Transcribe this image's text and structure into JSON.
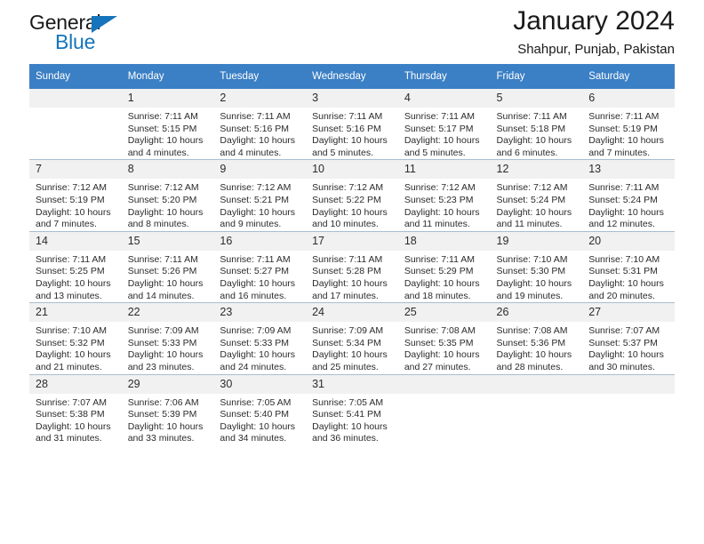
{
  "brand": {
    "name_top": "General",
    "name_bottom": "Blue",
    "accent_color": "#1574bb",
    "triangle_icon": "triangle-icon"
  },
  "header": {
    "month_title": "January 2024",
    "location": "Shahpur, Punjab, Pakistan"
  },
  "calendar": {
    "header_color": "#3b7fc4",
    "daynum_background": "#f1f1f1",
    "weekdays": [
      "Sunday",
      "Monday",
      "Tuesday",
      "Wednesday",
      "Thursday",
      "Friday",
      "Saturday"
    ],
    "weeks": [
      [
        {
          "day": "",
          "lines": []
        },
        {
          "day": "1",
          "lines": [
            "Sunrise: 7:11 AM",
            "Sunset: 5:15 PM",
            "Daylight: 10 hours",
            "and 4 minutes."
          ]
        },
        {
          "day": "2",
          "lines": [
            "Sunrise: 7:11 AM",
            "Sunset: 5:16 PM",
            "Daylight: 10 hours",
            "and 4 minutes."
          ]
        },
        {
          "day": "3",
          "lines": [
            "Sunrise: 7:11 AM",
            "Sunset: 5:16 PM",
            "Daylight: 10 hours",
            "and 5 minutes."
          ]
        },
        {
          "day": "4",
          "lines": [
            "Sunrise: 7:11 AM",
            "Sunset: 5:17 PM",
            "Daylight: 10 hours",
            "and 5 minutes."
          ]
        },
        {
          "day": "5",
          "lines": [
            "Sunrise: 7:11 AM",
            "Sunset: 5:18 PM",
            "Daylight: 10 hours",
            "and 6 minutes."
          ]
        },
        {
          "day": "6",
          "lines": [
            "Sunrise: 7:11 AM",
            "Sunset: 5:19 PM",
            "Daylight: 10 hours",
            "and 7 minutes."
          ]
        }
      ],
      [
        {
          "day": "7",
          "lines": [
            "Sunrise: 7:12 AM",
            "Sunset: 5:19 PM",
            "Daylight: 10 hours",
            "and 7 minutes."
          ]
        },
        {
          "day": "8",
          "lines": [
            "Sunrise: 7:12 AM",
            "Sunset: 5:20 PM",
            "Daylight: 10 hours",
            "and 8 minutes."
          ]
        },
        {
          "day": "9",
          "lines": [
            "Sunrise: 7:12 AM",
            "Sunset: 5:21 PM",
            "Daylight: 10 hours",
            "and 9 minutes."
          ]
        },
        {
          "day": "10",
          "lines": [
            "Sunrise: 7:12 AM",
            "Sunset: 5:22 PM",
            "Daylight: 10 hours",
            "and 10 minutes."
          ]
        },
        {
          "day": "11",
          "lines": [
            "Sunrise: 7:12 AM",
            "Sunset: 5:23 PM",
            "Daylight: 10 hours",
            "and 11 minutes."
          ]
        },
        {
          "day": "12",
          "lines": [
            "Sunrise: 7:12 AM",
            "Sunset: 5:24 PM",
            "Daylight: 10 hours",
            "and 11 minutes."
          ]
        },
        {
          "day": "13",
          "lines": [
            "Sunrise: 7:11 AM",
            "Sunset: 5:24 PM",
            "Daylight: 10 hours",
            "and 12 minutes."
          ]
        }
      ],
      [
        {
          "day": "14",
          "lines": [
            "Sunrise: 7:11 AM",
            "Sunset: 5:25 PM",
            "Daylight: 10 hours",
            "and 13 minutes."
          ]
        },
        {
          "day": "15",
          "lines": [
            "Sunrise: 7:11 AM",
            "Sunset: 5:26 PM",
            "Daylight: 10 hours",
            "and 14 minutes."
          ]
        },
        {
          "day": "16",
          "lines": [
            "Sunrise: 7:11 AM",
            "Sunset: 5:27 PM",
            "Daylight: 10 hours",
            "and 16 minutes."
          ]
        },
        {
          "day": "17",
          "lines": [
            "Sunrise: 7:11 AM",
            "Sunset: 5:28 PM",
            "Daylight: 10 hours",
            "and 17 minutes."
          ]
        },
        {
          "day": "18",
          "lines": [
            "Sunrise: 7:11 AM",
            "Sunset: 5:29 PM",
            "Daylight: 10 hours",
            "and 18 minutes."
          ]
        },
        {
          "day": "19",
          "lines": [
            "Sunrise: 7:10 AM",
            "Sunset: 5:30 PM",
            "Daylight: 10 hours",
            "and 19 minutes."
          ]
        },
        {
          "day": "20",
          "lines": [
            "Sunrise: 7:10 AM",
            "Sunset: 5:31 PM",
            "Daylight: 10 hours",
            "and 20 minutes."
          ]
        }
      ],
      [
        {
          "day": "21",
          "lines": [
            "Sunrise: 7:10 AM",
            "Sunset: 5:32 PM",
            "Daylight: 10 hours",
            "and 21 minutes."
          ]
        },
        {
          "day": "22",
          "lines": [
            "Sunrise: 7:09 AM",
            "Sunset: 5:33 PM",
            "Daylight: 10 hours",
            "and 23 minutes."
          ]
        },
        {
          "day": "23",
          "lines": [
            "Sunrise: 7:09 AM",
            "Sunset: 5:33 PM",
            "Daylight: 10 hours",
            "and 24 minutes."
          ]
        },
        {
          "day": "24",
          "lines": [
            "Sunrise: 7:09 AM",
            "Sunset: 5:34 PM",
            "Daylight: 10 hours",
            "and 25 minutes."
          ]
        },
        {
          "day": "25",
          "lines": [
            "Sunrise: 7:08 AM",
            "Sunset: 5:35 PM",
            "Daylight: 10 hours",
            "and 27 minutes."
          ]
        },
        {
          "day": "26",
          "lines": [
            "Sunrise: 7:08 AM",
            "Sunset: 5:36 PM",
            "Daylight: 10 hours",
            "and 28 minutes."
          ]
        },
        {
          "day": "27",
          "lines": [
            "Sunrise: 7:07 AM",
            "Sunset: 5:37 PM",
            "Daylight: 10 hours",
            "and 30 minutes."
          ]
        }
      ],
      [
        {
          "day": "28",
          "lines": [
            "Sunrise: 7:07 AM",
            "Sunset: 5:38 PM",
            "Daylight: 10 hours",
            "and 31 minutes."
          ]
        },
        {
          "day": "29",
          "lines": [
            "Sunrise: 7:06 AM",
            "Sunset: 5:39 PM",
            "Daylight: 10 hours",
            "and 33 minutes."
          ]
        },
        {
          "day": "30",
          "lines": [
            "Sunrise: 7:05 AM",
            "Sunset: 5:40 PM",
            "Daylight: 10 hours",
            "and 34 minutes."
          ]
        },
        {
          "day": "31",
          "lines": [
            "Sunrise: 7:05 AM",
            "Sunset: 5:41 PM",
            "Daylight: 10 hours",
            "and 36 minutes."
          ]
        },
        {
          "day": "",
          "lines": []
        },
        {
          "day": "",
          "lines": []
        },
        {
          "day": "",
          "lines": []
        }
      ]
    ]
  }
}
